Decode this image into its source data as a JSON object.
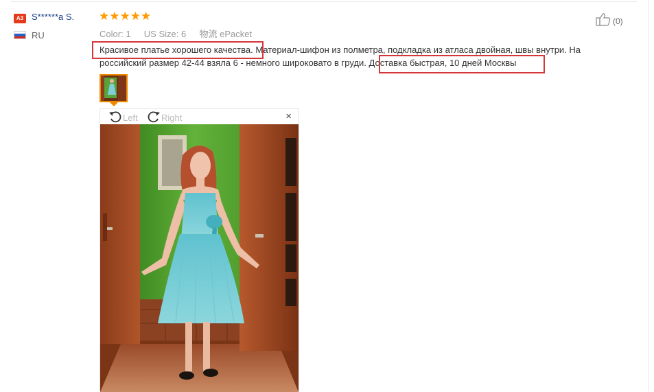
{
  "reviewer": {
    "badge": "A3",
    "name": "S******a S.",
    "country": "RU"
  },
  "rating": {
    "stars_text": "★★★★★",
    "value": 5,
    "max": 5
  },
  "meta": {
    "color_label": "Color:",
    "color_value": "1",
    "size_label": "US Size:",
    "size_value": "6",
    "shipping_label": "物流",
    "shipping_value": "ePacket"
  },
  "helpful": {
    "count": "(0)"
  },
  "review": {
    "part1": "Красивое платье хорошего качества.",
    "part2": " Материал-шифон из полметра, подкладка из атласа двойная, швы внутри. На российский размер 42-44 взяла 6 - немного широковато в груди.",
    "part3": " Доставка быстрая, 10 дней Москвы"
  },
  "viewer": {
    "rotate_left": "Left",
    "rotate_right": "Right",
    "close": "×"
  },
  "colors": {
    "accent_red": "#d6353a",
    "star_orange": "#ff9a00",
    "thumb_border": "#ef8a00",
    "name_blue": "#1a3e8c"
  }
}
